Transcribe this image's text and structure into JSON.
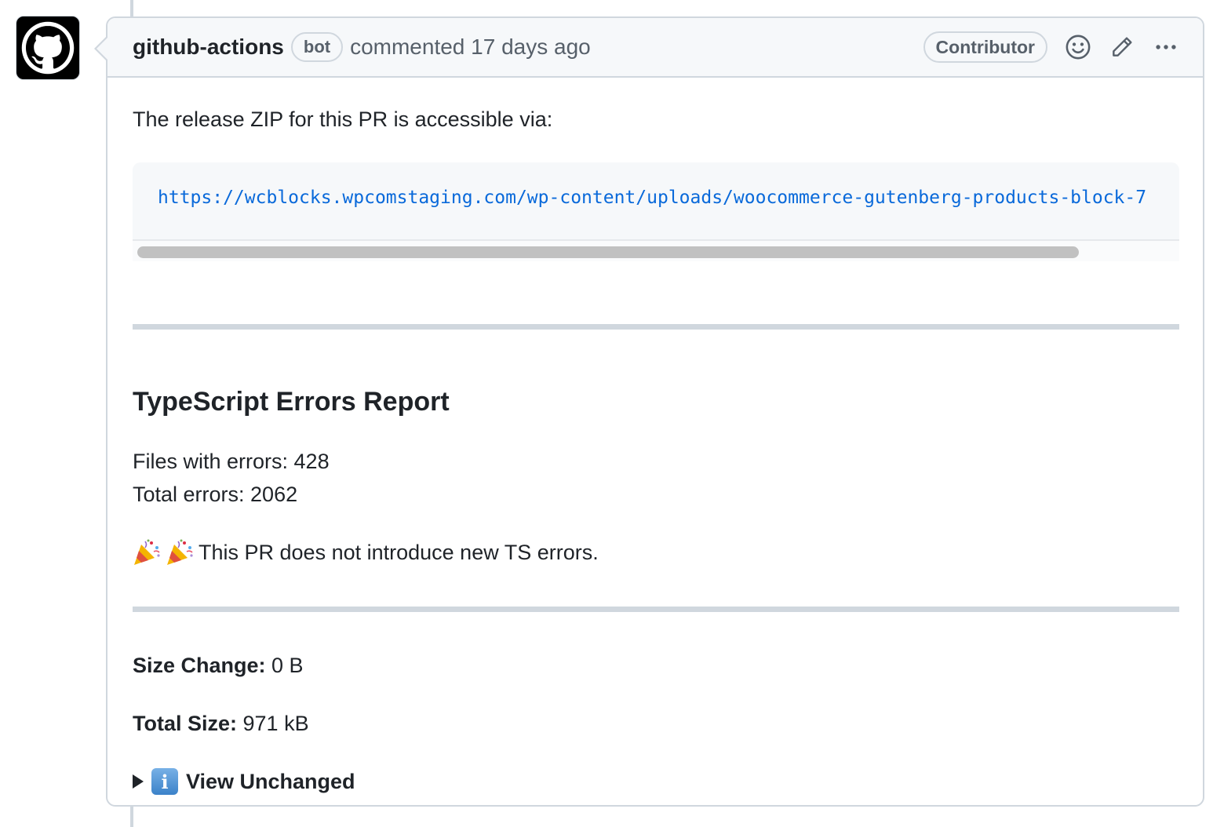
{
  "comment": {
    "author": "github-actions",
    "author_badge": "bot",
    "timestamp": "commented 17 days ago",
    "role_badge": "Contributor",
    "icons": {
      "reaction": "smiley-icon",
      "edit": "pencil-icon",
      "more": "kebab-horizontal-icon",
      "avatar": "github-mark-icon"
    }
  },
  "body": {
    "intro": "The release ZIP for this PR is accessible via:",
    "zip_url": "https://wcblocks.wpcomstaging.com/wp-content/uploads/woocommerce-gutenberg-products-block-7",
    "report_title": "TypeScript Errors Report",
    "files_with_errors": "Files with errors: 428",
    "total_errors": "Total errors: 2062",
    "success_message": "This PR does not introduce new TS errors.",
    "size_change_label": "Size Change:",
    "size_change_value": " 0 B",
    "total_size_label": "Total Size:",
    "total_size_value": " 971 kB",
    "details_summary": "View Unchanged"
  },
  "colors": {
    "link": "#0969da",
    "border": "#d0d7de",
    "header_bg": "#f6f8fa",
    "muted_text": "#57606a"
  }
}
